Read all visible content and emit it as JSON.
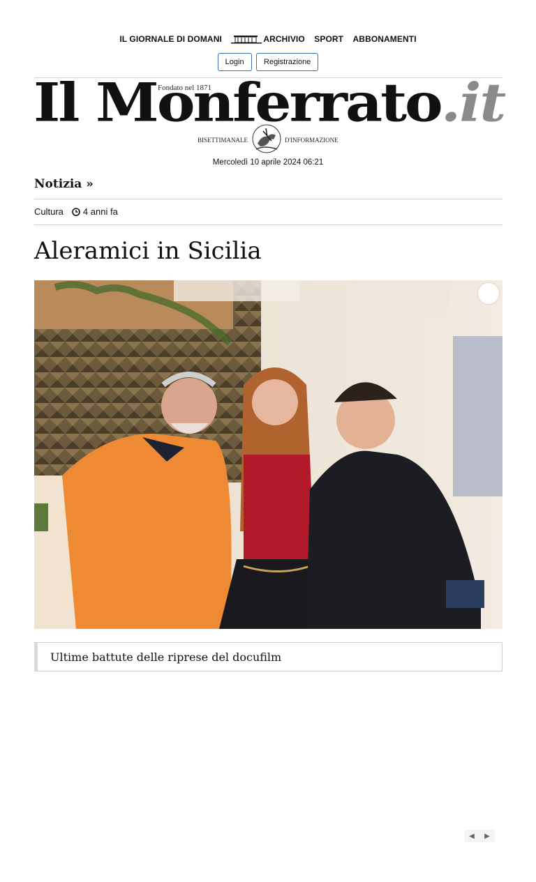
{
  "nav": {
    "items": [
      "IL GIORNALE DI DOMANI",
      "ARCHIVIO",
      "SPORT",
      "ABBONAMENTI"
    ]
  },
  "auth": {
    "login": "Login",
    "register": "Registrazione"
  },
  "logo": {
    "main": "Il Monferrato",
    "tld": ".it",
    "founded": "Fondato nel 1871",
    "sub_left": "BISETTIMANALE",
    "sub_right": "D'INFORMAZIONE"
  },
  "dateline": "Mercoledì 10 aprile 2024 06:21",
  "section": "Notizia »",
  "meta": {
    "category": "Cultura",
    "age": "4 anni fa"
  },
  "article": {
    "title": "Aleramici in Sicilia",
    "caption": "Ultime battute delle riprese del docufilm"
  },
  "pager": {
    "prev": "◀",
    "next": "▶"
  }
}
